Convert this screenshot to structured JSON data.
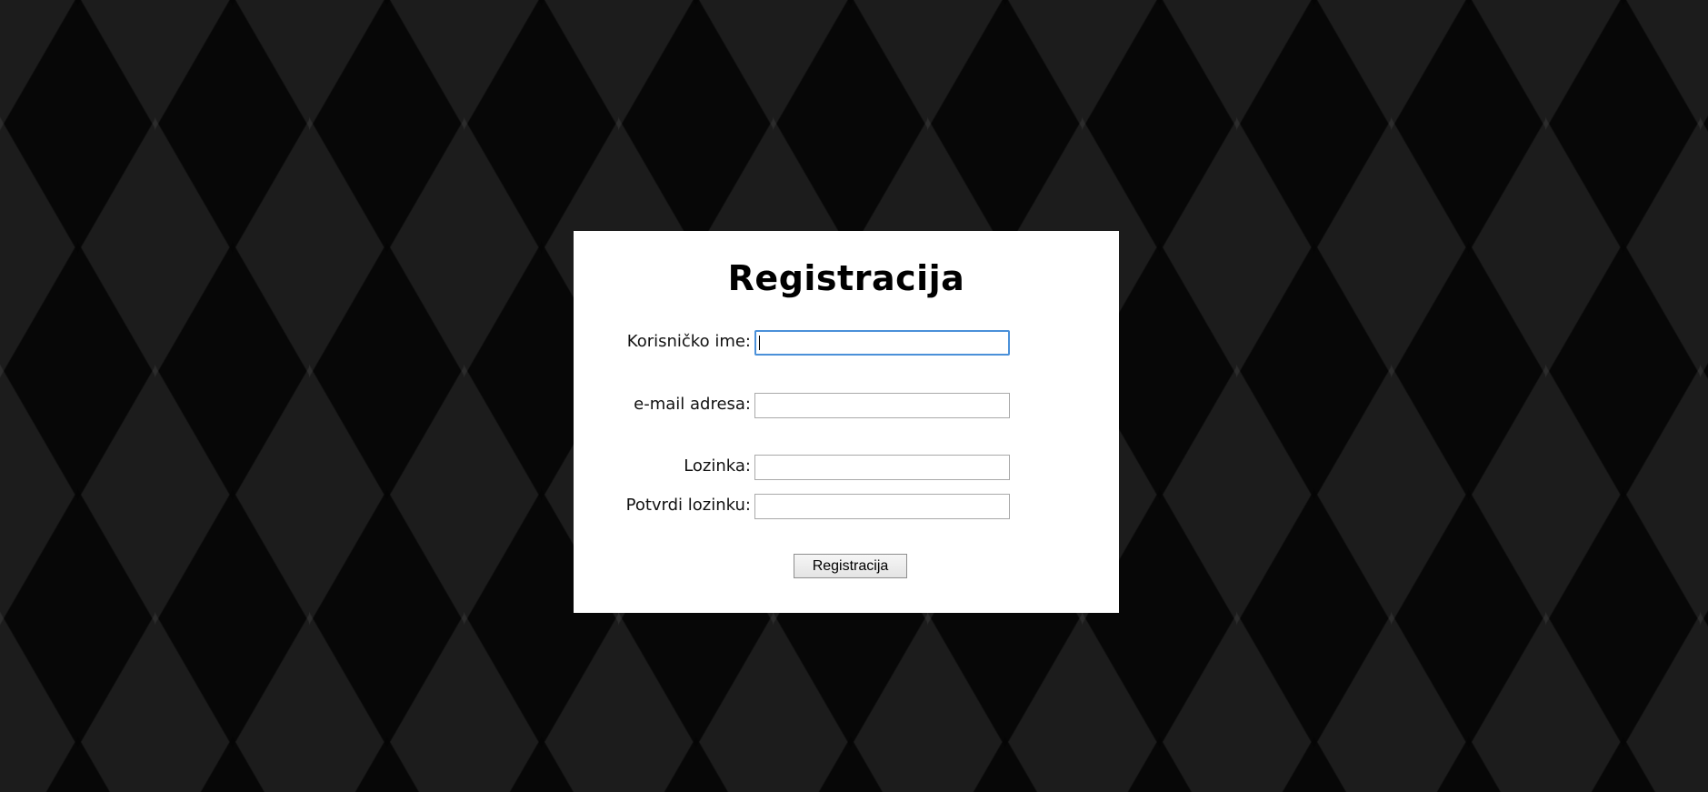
{
  "form": {
    "title": "Registracija",
    "fields": [
      {
        "label": "Korisničko ime:",
        "value": ""
      },
      {
        "label": "e-mail adresa:",
        "value": ""
      },
      {
        "label": "Lozinka:",
        "value": ""
      },
      {
        "label": "Potvrdi lozinku:",
        "value": ""
      }
    ],
    "submit_label": "Registracija",
    "focused_field": "username"
  },
  "colors": {
    "background": "#0b0b0b",
    "panel": "#ffffff",
    "focus_border": "#4a90d9"
  }
}
